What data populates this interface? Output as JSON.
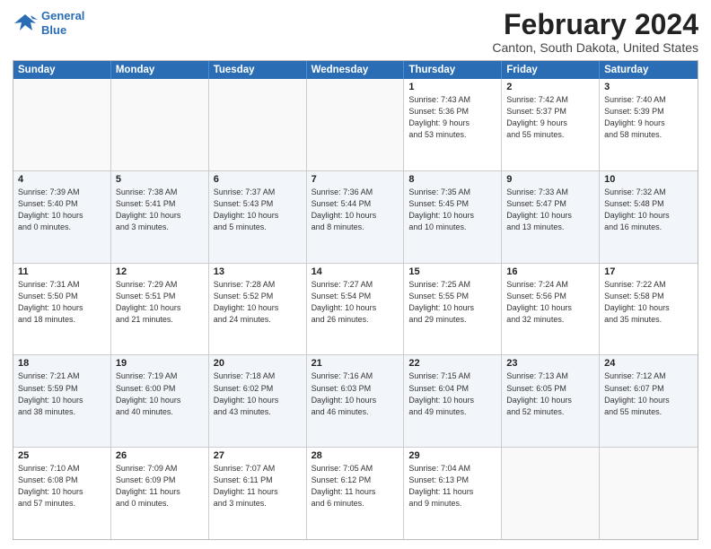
{
  "logo": {
    "line1": "General",
    "line2": "Blue"
  },
  "title": "February 2024",
  "subtitle": "Canton, South Dakota, United States",
  "days_of_week": [
    "Sunday",
    "Monday",
    "Tuesday",
    "Wednesday",
    "Thursday",
    "Friday",
    "Saturday"
  ],
  "weeks": [
    [
      {
        "day": "",
        "info": ""
      },
      {
        "day": "",
        "info": ""
      },
      {
        "day": "",
        "info": ""
      },
      {
        "day": "",
        "info": ""
      },
      {
        "day": "1",
        "info": "Sunrise: 7:43 AM\nSunset: 5:36 PM\nDaylight: 9 hours\nand 53 minutes."
      },
      {
        "day": "2",
        "info": "Sunrise: 7:42 AM\nSunset: 5:37 PM\nDaylight: 9 hours\nand 55 minutes."
      },
      {
        "day": "3",
        "info": "Sunrise: 7:40 AM\nSunset: 5:39 PM\nDaylight: 9 hours\nand 58 minutes."
      }
    ],
    [
      {
        "day": "4",
        "info": "Sunrise: 7:39 AM\nSunset: 5:40 PM\nDaylight: 10 hours\nand 0 minutes."
      },
      {
        "day": "5",
        "info": "Sunrise: 7:38 AM\nSunset: 5:41 PM\nDaylight: 10 hours\nand 3 minutes."
      },
      {
        "day": "6",
        "info": "Sunrise: 7:37 AM\nSunset: 5:43 PM\nDaylight: 10 hours\nand 5 minutes."
      },
      {
        "day": "7",
        "info": "Sunrise: 7:36 AM\nSunset: 5:44 PM\nDaylight: 10 hours\nand 8 minutes."
      },
      {
        "day": "8",
        "info": "Sunrise: 7:35 AM\nSunset: 5:45 PM\nDaylight: 10 hours\nand 10 minutes."
      },
      {
        "day": "9",
        "info": "Sunrise: 7:33 AM\nSunset: 5:47 PM\nDaylight: 10 hours\nand 13 minutes."
      },
      {
        "day": "10",
        "info": "Sunrise: 7:32 AM\nSunset: 5:48 PM\nDaylight: 10 hours\nand 16 minutes."
      }
    ],
    [
      {
        "day": "11",
        "info": "Sunrise: 7:31 AM\nSunset: 5:50 PM\nDaylight: 10 hours\nand 18 minutes."
      },
      {
        "day": "12",
        "info": "Sunrise: 7:29 AM\nSunset: 5:51 PM\nDaylight: 10 hours\nand 21 minutes."
      },
      {
        "day": "13",
        "info": "Sunrise: 7:28 AM\nSunset: 5:52 PM\nDaylight: 10 hours\nand 24 minutes."
      },
      {
        "day": "14",
        "info": "Sunrise: 7:27 AM\nSunset: 5:54 PM\nDaylight: 10 hours\nand 26 minutes."
      },
      {
        "day": "15",
        "info": "Sunrise: 7:25 AM\nSunset: 5:55 PM\nDaylight: 10 hours\nand 29 minutes."
      },
      {
        "day": "16",
        "info": "Sunrise: 7:24 AM\nSunset: 5:56 PM\nDaylight: 10 hours\nand 32 minutes."
      },
      {
        "day": "17",
        "info": "Sunrise: 7:22 AM\nSunset: 5:58 PM\nDaylight: 10 hours\nand 35 minutes."
      }
    ],
    [
      {
        "day": "18",
        "info": "Sunrise: 7:21 AM\nSunset: 5:59 PM\nDaylight: 10 hours\nand 38 minutes."
      },
      {
        "day": "19",
        "info": "Sunrise: 7:19 AM\nSunset: 6:00 PM\nDaylight: 10 hours\nand 40 minutes."
      },
      {
        "day": "20",
        "info": "Sunrise: 7:18 AM\nSunset: 6:02 PM\nDaylight: 10 hours\nand 43 minutes."
      },
      {
        "day": "21",
        "info": "Sunrise: 7:16 AM\nSunset: 6:03 PM\nDaylight: 10 hours\nand 46 minutes."
      },
      {
        "day": "22",
        "info": "Sunrise: 7:15 AM\nSunset: 6:04 PM\nDaylight: 10 hours\nand 49 minutes."
      },
      {
        "day": "23",
        "info": "Sunrise: 7:13 AM\nSunset: 6:05 PM\nDaylight: 10 hours\nand 52 minutes."
      },
      {
        "day": "24",
        "info": "Sunrise: 7:12 AM\nSunset: 6:07 PM\nDaylight: 10 hours\nand 55 minutes."
      }
    ],
    [
      {
        "day": "25",
        "info": "Sunrise: 7:10 AM\nSunset: 6:08 PM\nDaylight: 10 hours\nand 57 minutes."
      },
      {
        "day": "26",
        "info": "Sunrise: 7:09 AM\nSunset: 6:09 PM\nDaylight: 11 hours\nand 0 minutes."
      },
      {
        "day": "27",
        "info": "Sunrise: 7:07 AM\nSunset: 6:11 PM\nDaylight: 11 hours\nand 3 minutes."
      },
      {
        "day": "28",
        "info": "Sunrise: 7:05 AM\nSunset: 6:12 PM\nDaylight: 11 hours\nand 6 minutes."
      },
      {
        "day": "29",
        "info": "Sunrise: 7:04 AM\nSunset: 6:13 PM\nDaylight: 11 hours\nand 9 minutes."
      },
      {
        "day": "",
        "info": ""
      },
      {
        "day": "",
        "info": ""
      }
    ]
  ]
}
